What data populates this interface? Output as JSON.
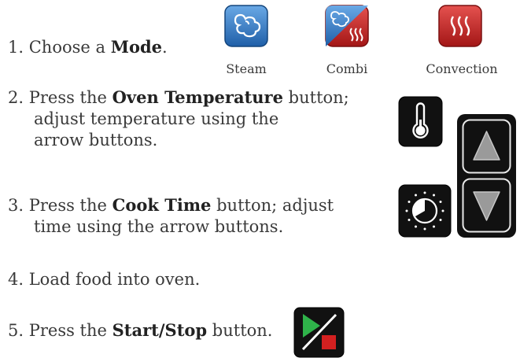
{
  "steps": [
    {
      "number": "1.",
      "before": "Choose a ",
      "bold": "Mode",
      "after": "."
    },
    {
      "number": "2.",
      "before": "Press the ",
      "bold": "Oven Temperature",
      "after": " button;",
      "line2": "adjust temperature using the",
      "line3": "arrow buttons."
    },
    {
      "number": "3.",
      "before": "Press the ",
      "bold": "Cook Time",
      "after": " button; adjust",
      "line2": "time using the arrow buttons."
    },
    {
      "number": "4.",
      "text": "Load food into oven."
    },
    {
      "number": "5.",
      "before": "Press the ",
      "bold": "Start/Stop",
      "after": " button."
    }
  ],
  "modes": [
    {
      "label": "Steam",
      "icon": "steam-icon",
      "color": "#2f79c4"
    },
    {
      "label": "Combi",
      "icon": "combi-icon",
      "color": "#c62828"
    },
    {
      "label": "Convection",
      "icon": "convection-icon",
      "color": "#c62828"
    }
  ],
  "controls": {
    "temperature": "thermometer-icon",
    "cook_time": "timer-dial-icon",
    "up": "up-arrow-icon",
    "down": "down-arrow-icon",
    "start_stop": "start-stop-icon"
  },
  "colors": {
    "panel": "#111111",
    "arrow": "#9a9a9a",
    "play": "#2fb34a",
    "stop": "#d32020"
  }
}
